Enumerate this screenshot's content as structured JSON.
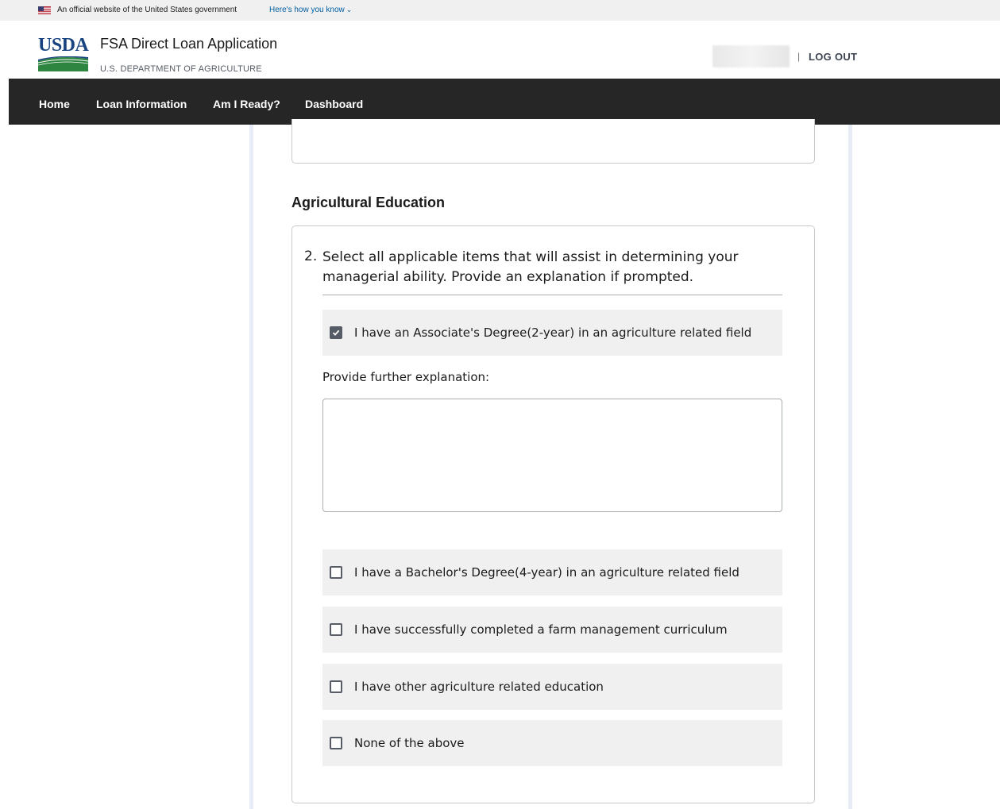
{
  "gov_banner": {
    "text": "An official website of the United States government",
    "link": "Here's how you know"
  },
  "header": {
    "logo_text": "USDA",
    "app_title": "FSA Direct Loan Application",
    "department": "U.S. DEPARTMENT OF AGRICULTURE",
    "separator": "|",
    "logout_label": "LOG OUT"
  },
  "nav": {
    "items": [
      {
        "label": "Home"
      },
      {
        "label": "Loan Information"
      },
      {
        "label": "Am I Ready?"
      },
      {
        "label": "Dashboard"
      }
    ]
  },
  "section": {
    "title": "Agricultural Education",
    "question_number": "2.",
    "question_text": "Select all applicable items that will assist in determining your managerial ability. Provide an explanation if prompted.",
    "options": [
      {
        "label": "I have an Associate's Degree(2-year) in an agriculture related field",
        "checked": true
      },
      {
        "label": "I have a Bachelor's Degree(4-year) in an agriculture related field",
        "checked": false
      },
      {
        "label": "I have successfully completed a farm management curriculum",
        "checked": false
      },
      {
        "label": "I have other agriculture related education",
        "checked": false
      },
      {
        "label": "None of the above",
        "checked": false
      }
    ],
    "explanation_label": "Provide further explanation:",
    "explanation_value": ""
  },
  "colors": {
    "nav_bg": "#262626",
    "logo_blue": "#1a4480",
    "logo_green": "#2e8540",
    "option_bg": "#f0f0f0",
    "checkbox_checked": "#565c65"
  }
}
